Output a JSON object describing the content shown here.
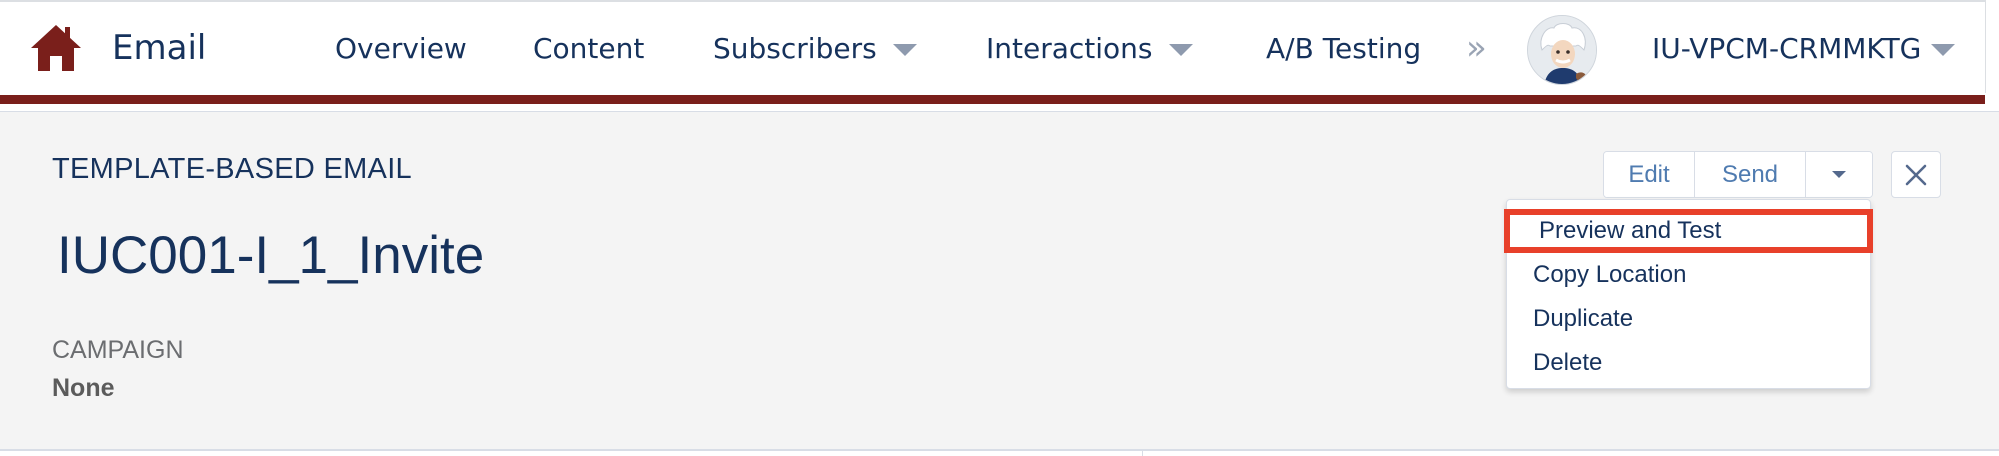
{
  "app": {
    "name": "Email",
    "home_icon": "home-icon",
    "accent_color": "#7a1f1b"
  },
  "nav": {
    "items": [
      {
        "label": "Overview",
        "has_menu": false
      },
      {
        "label": "Content",
        "has_menu": false
      },
      {
        "label": "Subscribers",
        "has_menu": true
      },
      {
        "label": "Interactions",
        "has_menu": true
      },
      {
        "label": "A/B Testing",
        "has_menu": false
      }
    ],
    "more_glyph": "»",
    "user": {
      "account_name": "IU-VPCM-CRMMKTG",
      "avatar_icon": "einstein-avatar-icon"
    }
  },
  "record": {
    "type_label": "TEMPLATE-BASED EMAIL",
    "title": "IUC001-I_1_Invite",
    "campaign_label": "CAMPAIGN",
    "campaign_value": "None"
  },
  "actions": {
    "edit_label": "Edit",
    "send_label": "Send",
    "close_icon": "close-icon"
  },
  "dropdown": {
    "items": [
      {
        "label": "Preview and Test",
        "highlighted": true
      },
      {
        "label": "Copy Location",
        "highlighted": false
      },
      {
        "label": "Duplicate",
        "highlighted": false
      },
      {
        "label": "Delete",
        "highlighted": false
      }
    ],
    "highlight_color": "#e8402a"
  }
}
